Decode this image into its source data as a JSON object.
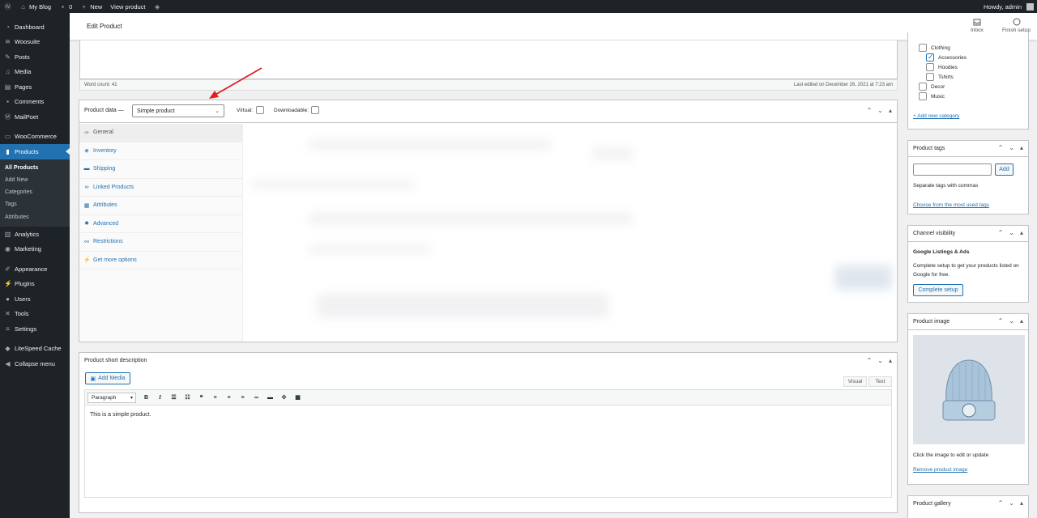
{
  "adminbar": {
    "site": "My Blog",
    "comments_count": "0",
    "new": "New",
    "view": "View product",
    "howdy": "Howdy, admin"
  },
  "sidebar": {
    "items": [
      {
        "label": "Dashboard",
        "icon": "dashboard-icon"
      },
      {
        "label": "Woosuite",
        "icon": "woosuite-icon"
      },
      {
        "label": "Posts",
        "icon": "pin-icon"
      },
      {
        "label": "Media",
        "icon": "media-icon"
      },
      {
        "label": "Pages",
        "icon": "pages-icon"
      },
      {
        "label": "Comments",
        "icon": "comments-icon"
      },
      {
        "label": "MailPoet",
        "icon": "mailpoet-icon"
      },
      {
        "label": "WooCommerce",
        "icon": "woocommerce-icon"
      },
      {
        "label": "Products",
        "icon": "products-icon"
      },
      {
        "label": "Analytics",
        "icon": "analytics-icon"
      },
      {
        "label": "Marketing",
        "icon": "marketing-icon"
      },
      {
        "label": "Appearance",
        "icon": "appearance-icon"
      },
      {
        "label": "Plugins",
        "icon": "plugins-icon"
      },
      {
        "label": "Users",
        "icon": "users-icon"
      },
      {
        "label": "Tools",
        "icon": "tools-icon"
      },
      {
        "label": "Settings",
        "icon": "settings-icon"
      },
      {
        "label": "LiteSpeed Cache",
        "icon": "litespeed-icon"
      },
      {
        "label": "Collapse menu",
        "icon": "collapse-icon"
      }
    ],
    "submenu": [
      "All Products",
      "Add New",
      "Categories",
      "Tags",
      "Attributes"
    ]
  },
  "header": {
    "title": "Edit Product",
    "inbox": "Inbox",
    "finish_setup": "Finish setup"
  },
  "editor": {
    "word_count": "Word count: 41",
    "last_edited": "Last edited on December 26, 2021 at 7:23 am"
  },
  "product_data": {
    "label": "Product data —",
    "type_selected": "Simple product",
    "virtual": "Virtual:",
    "downloadable": "Downloadable:",
    "tabs": [
      {
        "label": "General",
        "icon": "wrench-icon"
      },
      {
        "label": "Inventory",
        "icon": "diamond-icon"
      },
      {
        "label": "Shipping",
        "icon": "truck-icon"
      },
      {
        "label": "Linked Products",
        "icon": "link-icon"
      },
      {
        "label": "Attributes",
        "icon": "table-icon"
      },
      {
        "label": "Advanced",
        "icon": "gear-icon"
      },
      {
        "label": "Restrictions",
        "icon": "restrictions-icon"
      },
      {
        "label": "Get more options",
        "icon": "plugin-icon"
      }
    ]
  },
  "short_description": {
    "title": "Product short description",
    "add_media": "Add Media",
    "visual": "Visual",
    "text": "Text",
    "format": "Paragraph",
    "content": "This is a simple product."
  },
  "categories": {
    "items": [
      {
        "label": "Clothing",
        "checked": false,
        "level": 0
      },
      {
        "label": "Accessories",
        "checked": true,
        "level": 1
      },
      {
        "label": "Hoodies",
        "checked": false,
        "level": 1
      },
      {
        "label": "Tshirts",
        "checked": false,
        "level": 1
      },
      {
        "label": "Decor",
        "checked": false,
        "level": 0
      },
      {
        "label": "Music",
        "checked": false,
        "level": 0
      }
    ],
    "add_new": "+ Add new category"
  },
  "tags": {
    "title": "Product tags",
    "add": "Add",
    "help": "Separate tags with commas",
    "choose": "Choose from the most used tags"
  },
  "channel": {
    "title": "Channel visibility",
    "heading": "Google Listings & Ads",
    "desc": "Complete setup to get your products listed on Google for free.",
    "button": "Complete setup"
  },
  "product_image": {
    "title": "Product image",
    "hint": "Click the image to edit or update",
    "remove": "Remove product image"
  },
  "gallery": {
    "title": "Product gallery"
  },
  "colors": {
    "accent": "#2271b1",
    "adminbar": "#1d2327",
    "arrow": "#e02020"
  }
}
